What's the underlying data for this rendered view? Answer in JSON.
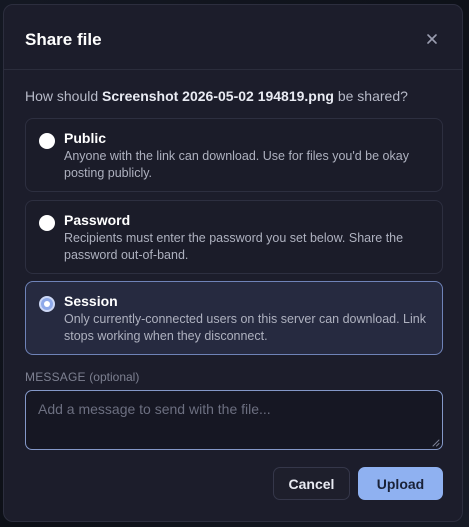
{
  "dialog": {
    "title": "Share file",
    "close_icon": "close-icon"
  },
  "question": {
    "prefix": "How should ",
    "filename": "Screenshot 2026-05-02 194819.png",
    "suffix": " be shared?"
  },
  "options": [
    {
      "title": "Public",
      "description": "Anyone with the link can download. Use for files you'd be okay posting publicly.",
      "selected": false
    },
    {
      "title": "Password",
      "description": "Recipients must enter the password you set below. Share the password out-of-band.",
      "selected": false
    },
    {
      "title": "Session",
      "description": "Only currently-connected users on this server can download. Link stops working when they disconnect.",
      "selected": true
    }
  ],
  "message": {
    "label": "MESSAGE",
    "label_hint": "(optional)",
    "value": "",
    "placeholder": "Add a message to send with the file..."
  },
  "buttons": {
    "cancel": "Cancel",
    "upload": "Upload"
  },
  "colors": {
    "accent": "#8fb1f1",
    "dialog_bg": "#1c1d2b",
    "selected_border": "#6f83b8"
  }
}
